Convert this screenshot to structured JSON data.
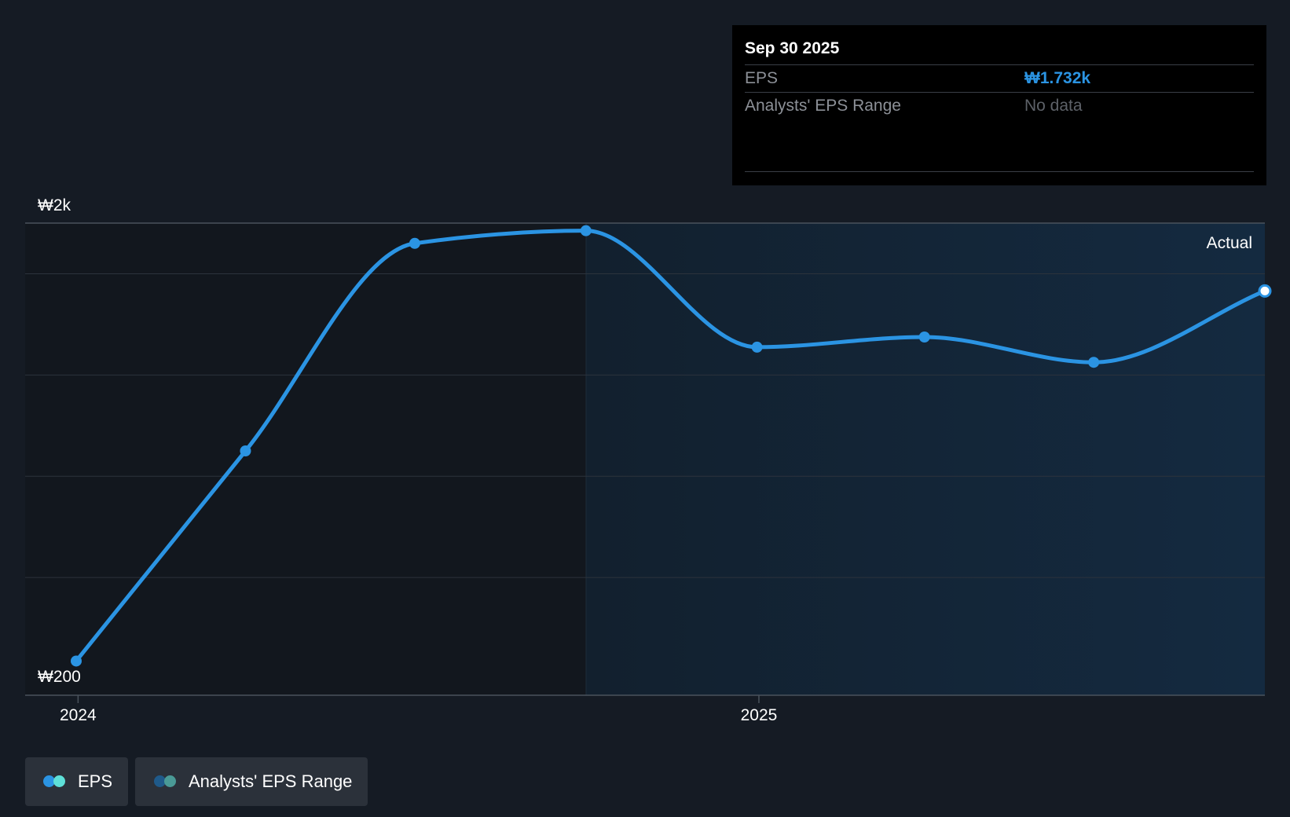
{
  "chart_data": {
    "type": "line",
    "y_axis_labels": [
      "₩2k",
      "₩200"
    ],
    "x_tick_labels": [
      "2024",
      "2025"
    ],
    "ylim": [
      200,
      2000
    ],
    "grid": true,
    "region_label": "Actual",
    "series": [
      {
        "name": "EPS",
        "color": "#2b94e3",
        "x": [
          "2023-12-31",
          "2024-03-31",
          "2024-06-30",
          "2024-09-30",
          "2024-12-31",
          "2025-03-31",
          "2025-06-30",
          "2025-09-30"
        ],
        "values": [
          270,
          1100,
          1920,
          1970,
          1510,
          1550,
          1450,
          1732
        ]
      }
    ]
  },
  "tooltip": {
    "date": "Sep 30 2025",
    "rows": [
      {
        "label": "EPS",
        "value": "₩1.732k",
        "value_color": "#2b94e3"
      },
      {
        "label": "Analysts' EPS Range",
        "value": "No data",
        "value_color": "#5d6168"
      }
    ]
  },
  "legend": {
    "items": [
      {
        "label": "EPS",
        "colors": [
          "#2b94e3",
          "#5ee0d8"
        ]
      },
      {
        "label": "Analysts' EPS Range",
        "colors": [
          "#1f5a8a",
          "#4a9a96"
        ]
      }
    ]
  },
  "colors": {
    "background": "#151b24",
    "past_panel": "#12171e",
    "actual_panel": "#132334",
    "line": "#2b94e3",
    "grid": "#2c333c"
  }
}
